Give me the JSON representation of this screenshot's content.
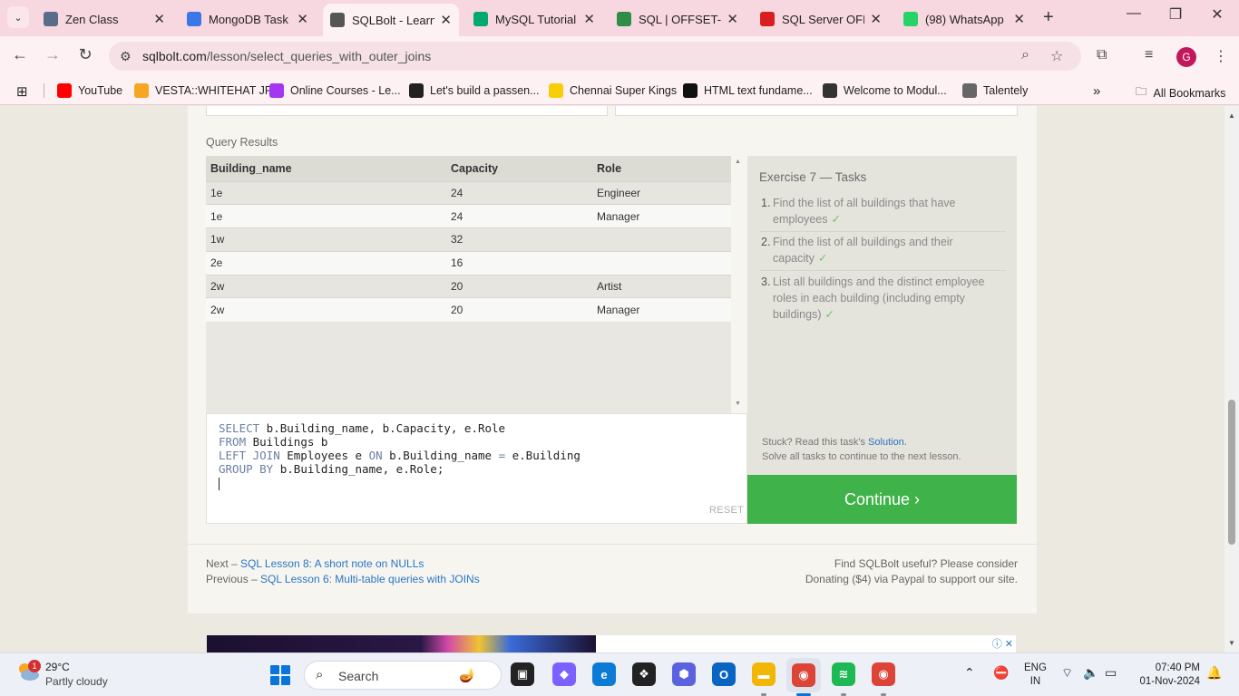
{
  "browser": {
    "tabs": [
      {
        "label": "Zen Class",
        "icon": "zen-class-favicon",
        "color": "#5b6b8a"
      },
      {
        "label": "MongoDB Task -",
        "icon": "google-docs-favicon",
        "color": "#3b78e7"
      },
      {
        "label": "SQLBolt - Learn",
        "icon": "database-favicon",
        "color": "#555555"
      },
      {
        "label": "MySQL Tutorial",
        "icon": "w3schools-favicon",
        "color": "#04aa6d"
      },
      {
        "label": "SQL | OFFSET-FE",
        "icon": "geeksforgeeks-favicon",
        "color": "#2f8d46"
      },
      {
        "label": "SQL Server OFFS",
        "icon": "tutorial-v-favicon",
        "color": "#d81e1e"
      },
      {
        "label": "(98) WhatsApp",
        "icon": "whatsapp-favicon",
        "color": "#25d366"
      }
    ],
    "active_tab_index": 2,
    "url_domain": "sqlbolt.com",
    "url_path": "/lesson/select_queries_with_outer_joins",
    "profile_initial": "G",
    "bookmarks": [
      {
        "label": "YouTube",
        "icon": "youtube-icon",
        "color": "#ff0000"
      },
      {
        "label": "VESTA::WHITEHAT JR",
        "icon": "whitehat-icon",
        "color": "#f5a623"
      },
      {
        "label": "Online Courses - Le...",
        "icon": "udemy-icon",
        "color": "#a435f0"
      },
      {
        "label": "Let's build a passen...",
        "icon": "video-icon",
        "color": "#222222"
      },
      {
        "label": "Chennai Super Kings",
        "icon": "csk-icon",
        "color": "#f9cd05"
      },
      {
        "label": "HTML text fundame...",
        "icon": "mdn-icon",
        "color": "#111111"
      },
      {
        "label": "Welcome to Modul...",
        "icon": "globe-icon",
        "color": "#333333"
      },
      {
        "label": "Talentely",
        "icon": "talentely-icon",
        "color": "#666666"
      }
    ],
    "all_bookmarks_label": "All Bookmarks"
  },
  "page": {
    "query_results_title": "Query Results",
    "table": {
      "headers": [
        "Building_name",
        "Capacity",
        "Role"
      ],
      "rows": [
        [
          "1e",
          "24",
          "Engineer"
        ],
        [
          "1e",
          "24",
          "Manager"
        ],
        [
          "1w",
          "32",
          ""
        ],
        [
          "2e",
          "16",
          ""
        ],
        [
          "2w",
          "20",
          "Artist"
        ],
        [
          "2w",
          "20",
          "Manager"
        ]
      ]
    },
    "editor": {
      "lines": [
        [
          {
            "t": "SELECT",
            "k": true
          },
          {
            "t": " b.Building_name, b.Capacity, e.Role",
            "k": false
          }
        ],
        [
          {
            "t": "FROM",
            "k": true
          },
          {
            "t": " Buildings b",
            "k": false
          }
        ],
        [
          {
            "t": "LEFT JOIN",
            "k": true
          },
          {
            "t": " Employees e ",
            "k": false
          },
          {
            "t": "ON",
            "k": true
          },
          {
            "t": " b.Building_name ",
            "k": false
          },
          {
            "t": "=",
            "k": true
          },
          {
            "t": " e.Building",
            "k": false
          }
        ],
        [
          {
            "t": "GROUP BY",
            "k": true
          },
          {
            "t": " b.Building_name, e.Role;",
            "k": false
          }
        ]
      ],
      "reset_label": "RESET"
    },
    "tasks_panel": {
      "title": "Exercise 7 — Tasks",
      "tasks": [
        {
          "num": "1.",
          "text": "Find the list of all buildings that have employees",
          "done": "✓"
        },
        {
          "num": "2.",
          "text": "Find the list of all buildings and their capacity",
          "done": "✓"
        },
        {
          "num": "3.",
          "text": "List all buildings and the distinct employee roles in each building (including empty buildings)",
          "done": "✓"
        }
      ],
      "stuck_prefix": "Stuck? Read this task's ",
      "stuck_link": "Solution.",
      "stuck_line2": "Solve all tasks to continue to the next lesson.",
      "continue_label": "Continue ›",
      "accent_color": "#3fb34a"
    },
    "footer": {
      "next_prefix": "Next – ",
      "next_link": "SQL Lesson 8: A short note on NULLs",
      "prev_prefix": "Previous – ",
      "prev_link": "SQL Lesson 6: Multi-table queries with JOINs",
      "donate_line1": "Find SQLBolt useful? Please consider",
      "donate_link": "Donating ($4) via Paypal",
      "donate_suffix": " to support our site."
    },
    "ad_mark": "ⓘ ✕"
  },
  "taskbar": {
    "weather_badge": "1",
    "temperature": "29°C",
    "weather": "Partly cloudy",
    "search_label": "Search",
    "apps": [
      {
        "name": "task-view-icon",
        "color": "#222222"
      },
      {
        "name": "copilot-icon",
        "color": "#7b61ff"
      },
      {
        "name": "edge-icon",
        "color": "#0c7bd6"
      },
      {
        "name": "dropbox-icon",
        "color": "#222222"
      },
      {
        "name": "gem-app-icon",
        "color": "#5a62e0"
      },
      {
        "name": "outlook-icon",
        "color": "#0a64c2"
      },
      {
        "name": "file-explorer-icon",
        "color": "#f2b705"
      },
      {
        "name": "chrome-icon",
        "color": "#db4437"
      },
      {
        "name": "spotify-icon",
        "color": "#1db954"
      },
      {
        "name": "chrome-profile-icon",
        "color": "#db4437"
      }
    ],
    "language_line1": "ENG",
    "language_line2": "IN",
    "time": "07:40 PM",
    "date": "01-Nov-2024"
  }
}
